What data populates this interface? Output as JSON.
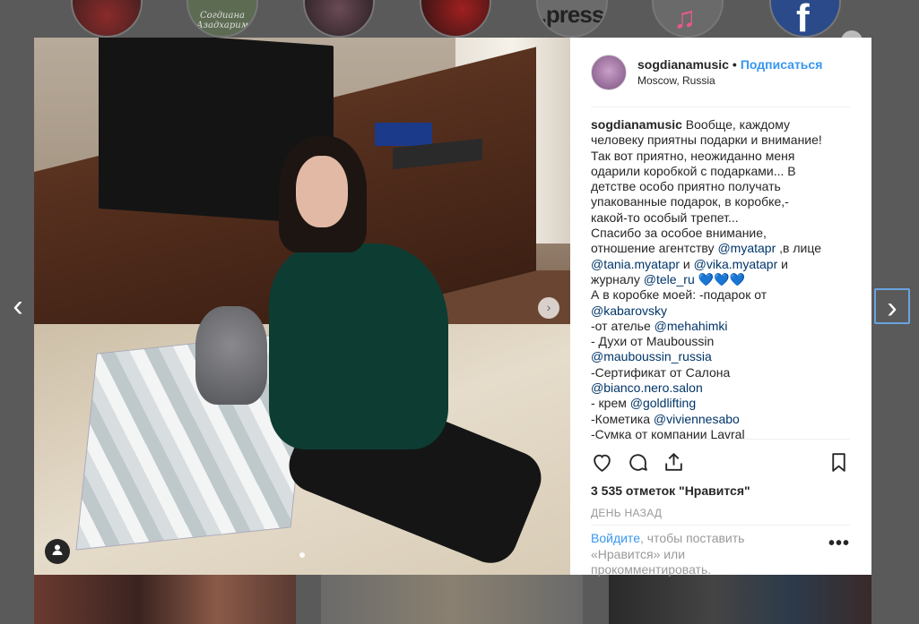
{
  "highlights": [
    {
      "label": ""
    },
    {
      "label": "Согдиана Азадхарим"
    },
    {
      "label": ""
    },
    {
      "label": ""
    },
    {
      "label": ".press"
    },
    {
      "label": ""
    },
    {
      "label": "f"
    }
  ],
  "nav": {
    "prev": "‹",
    "next": "›",
    "highlights_next": "›"
  },
  "post": {
    "username": "sogdianamusic",
    "follow_label": "Подписаться",
    "location": "Moscow, Russia",
    "caption_lines": [
      {
        "pre_user": "sogdianamusic",
        "text": " Вообще, каждому"
      },
      {
        "text": "человеку приятны подарки и внимание!"
      },
      {
        "text": "Так вот приятно, неожиданно меня"
      },
      {
        "text": "одарили коробкой с подарками... В"
      },
      {
        "text": "детстве особо приятно получать"
      },
      {
        "text": "упакованные подарок, в коробке,-"
      },
      {
        "text": "какой-то особый трепет..."
      },
      {
        "text": "Спасибо за особое внимание,"
      },
      {
        "text": "отношение агентству ",
        "mention": "@myatapr",
        "after": " ,в лице"
      },
      {
        "mention": "@tania.myatapr",
        "after": " и ",
        "mention2": "@vika.myatapr",
        "after2": " и"
      },
      {
        "text": "журналу ",
        "mention": "@tele_ru",
        "after": " ",
        "hearts": "💙💙💙"
      },
      {
        "text": "А в коробке моей: -подарок от"
      },
      {
        "mention": "@kabarovsky"
      },
      {
        "text": "-от ателье ",
        "mention": "@mehahimki"
      },
      {
        "text": "- Духи от Mauboussin"
      },
      {
        "mention": "@mauboussin_russia"
      },
      {
        "text": "-Сертификат от Салона"
      },
      {
        "mention": "@bianco.nero.salon"
      },
      {
        "text": "- крем ",
        "mention": "@goldlifting"
      },
      {
        "text": "-Кометика ",
        "mention": "@viviennesabo"
      },
      {
        "text": "-Сумка от компании Lavral"
      }
    ],
    "likes": "3 535 отметок \"Нравится\"",
    "date": "ДЕНЬ НАЗАД",
    "login_link": "Войдите",
    "login_rest_1": ", чтобы поставить",
    "login_rest_2": "«Нравится» или",
    "login_rest_3": "прокомментировать.",
    "more": "•••",
    "carousel_next": "›",
    "user_tag_icon": "person-icon"
  },
  "colors": {
    "accent": "#3897f0",
    "mention": "#003569",
    "text": "#262626",
    "muted": "#999999"
  }
}
